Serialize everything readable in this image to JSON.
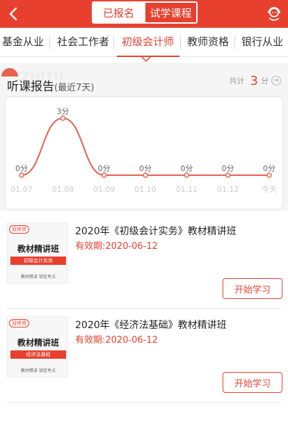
{
  "header": {
    "tabs": [
      {
        "label": "已报名"
      },
      {
        "label": "试学课程"
      }
    ],
    "accent_color": "#e8402f",
    "icons": {
      "back": "chevron-left-icon",
      "service": "customer-service-icon"
    }
  },
  "categories": [
    {
      "label": "基金从业"
    },
    {
      "label": "社会工作者"
    },
    {
      "label": "初级会计师"
    },
    {
      "label": "教师资格"
    },
    {
      "label": "银行从业"
    }
  ],
  "report": {
    "title": "听课报告",
    "subtitle": "(最近7天)",
    "total_label": "共计",
    "total_value": "3",
    "total_unit": "分"
  },
  "chart_data": {
    "type": "line",
    "x": [
      "01.07",
      "01.08",
      "01.09",
      "01.10",
      "01.11",
      "01.12",
      "今天"
    ],
    "values": [
      0,
      3,
      0,
      0,
      0,
      0,
      0
    ],
    "point_labels": [
      "0分",
      "3分",
      "0分",
      "0分",
      "0分",
      "0分",
      "0分"
    ],
    "ylim": [
      0,
      3
    ],
    "line_color": "#e8604f",
    "grid": false
  },
  "courses": [
    {
      "tag": "双师资",
      "thumb_title": "教材精讲班",
      "thumb_subject": "初级会计实务",
      "thumb_footer": "教材精讲  锁定考点",
      "title": "2020年《初级会计实务》教材精讲班",
      "validity": "有效期:2020-06-12",
      "button": "开始学习"
    },
    {
      "tag": "双师资",
      "thumb_title": "教材精讲班",
      "thumb_subject": "经济法基础",
      "thumb_footer": "教材精讲  锁定考点",
      "title": "2020年《经济法基础》教材精讲班",
      "validity": "有效期:2020-06-12",
      "button": "开始学习"
    }
  ]
}
